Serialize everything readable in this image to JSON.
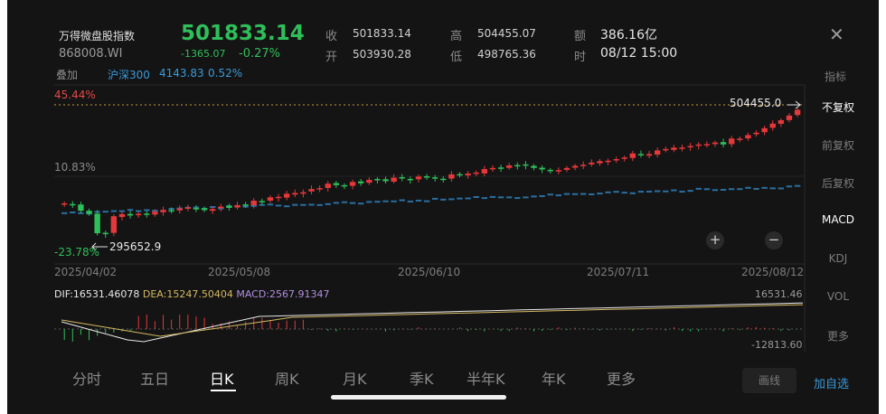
{
  "header": {
    "name": "万得微盘股指数",
    "code": "868008.WI",
    "price": "501833.14",
    "change": "-1365.07",
    "change_pct": "-0.27%",
    "quote": [
      {
        "label": "收",
        "value": "501833.14"
      },
      {
        "label": "开",
        "value": "503930.28"
      },
      {
        "label": "高",
        "value": "504455.07"
      },
      {
        "label": "低",
        "value": "498765.36"
      },
      {
        "label": "额",
        "value": "386.16亿"
      },
      {
        "label": "时",
        "value": "08/12 15:00"
      }
    ],
    "close_glyph": "✕"
  },
  "overlay": {
    "label": "叠加",
    "name": "沪深300",
    "value": "4143.83",
    "pct": "0.52%"
  },
  "chart": {
    "pct_top": "45.44%",
    "pct_mid": "10.83%",
    "pct_bottom": "-23.78%",
    "high_label": "504455.0",
    "low_label": "295652.9",
    "dates": [
      "2025/04/02",
      "2025/05/08",
      "2025/06/10",
      "2025/07/11",
      "2025/08/12"
    ],
    "zoom_in": "+",
    "zoom_out": "−",
    "colors": {
      "up": "#e5383b",
      "down": "#2fbf5a",
      "overlay": "#2a6fa0",
      "dif": "#e8e8e8",
      "dea": "#d4b860",
      "macd": "#b08fe0"
    }
  },
  "macd": {
    "dif": "DIF:16531.46078",
    "dea": "DEA:15247.50404",
    "macd": "MACD:2567.91347",
    "max": "16531.46",
    "min": "-12813.60"
  },
  "sidebar": {
    "title": "指标",
    "items": [
      {
        "label": "不复权",
        "active": true
      },
      {
        "label": "前复权",
        "active": false
      },
      {
        "label": "后复权",
        "active": false
      },
      {
        "label": "MACD",
        "active": true
      },
      {
        "label": "KDJ",
        "active": false
      },
      {
        "label": "VOL",
        "active": false
      },
      {
        "label": "更多",
        "active": false
      }
    ]
  },
  "tabs": [
    "分时",
    "五日",
    "日K",
    "周K",
    "月K",
    "季K",
    "半年K",
    "年K",
    "更多"
  ],
  "active_tab": "日K",
  "actions": {
    "draw": "画线",
    "add": "加自选"
  }
}
